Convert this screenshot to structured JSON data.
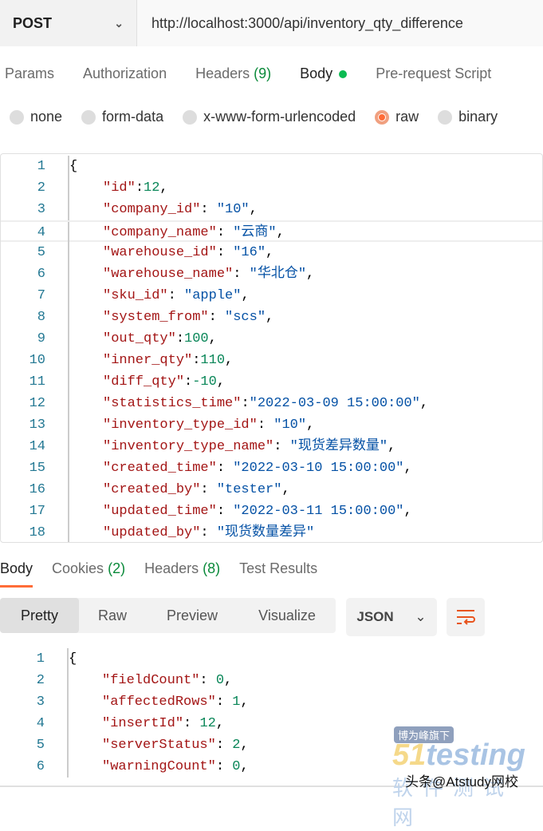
{
  "request": {
    "method": "POST",
    "url": "http://localhost:3000/api/inventory_qty_difference"
  },
  "tabs": [
    {
      "label": "Params"
    },
    {
      "label": "Authorization"
    },
    {
      "label": "Headers",
      "count": "(9)"
    },
    {
      "label": "Body",
      "active": true
    },
    {
      "label": "Pre-request Script"
    }
  ],
  "body_types": [
    {
      "label": "none"
    },
    {
      "label": "form-data"
    },
    {
      "label": "x-www-form-urlencoded"
    },
    {
      "label": "raw",
      "selected": true
    },
    {
      "label": "binary"
    }
  ],
  "request_body": [
    {
      "n": "1",
      "parts": [
        [
          "p",
          "{"
        ]
      ]
    },
    {
      "n": "2",
      "parts": [
        [
          "k",
          "\"id\""
        ],
        [
          "p",
          ":"
        ],
        [
          "n",
          "12"
        ],
        [
          "p",
          ","
        ]
      ]
    },
    {
      "n": "3",
      "parts": [
        [
          "k",
          "\"company_id\""
        ],
        [
          "p",
          ": "
        ],
        [
          "s",
          "\"10\""
        ],
        [
          "p",
          ","
        ]
      ]
    },
    {
      "n": "4",
      "parts": [
        [
          "k",
          "\"company_name\""
        ],
        [
          "p",
          ": "
        ],
        [
          "s",
          "\"云商\""
        ],
        [
          "p",
          ","
        ]
      ]
    },
    {
      "n": "5",
      "parts": [
        [
          "k",
          "\"warehouse_id\""
        ],
        [
          "p",
          ": "
        ],
        [
          "s",
          "\"16\""
        ],
        [
          "p",
          ","
        ]
      ]
    },
    {
      "n": "6",
      "parts": [
        [
          "k",
          "\"warehouse_name\""
        ],
        [
          "p",
          ": "
        ],
        [
          "s",
          "\"华北仓\""
        ],
        [
          "p",
          ","
        ]
      ]
    },
    {
      "n": "7",
      "parts": [
        [
          "k",
          "\"sku_id\""
        ],
        [
          "p",
          ": "
        ],
        [
          "s",
          "\"apple\""
        ],
        [
          "p",
          ","
        ]
      ]
    },
    {
      "n": "8",
      "parts": [
        [
          "k",
          "\"system_from\""
        ],
        [
          "p",
          ": "
        ],
        [
          "s",
          "\"scs\""
        ],
        [
          "p",
          ","
        ]
      ]
    },
    {
      "n": "9",
      "parts": [
        [
          "k",
          "\"out_qty\""
        ],
        [
          "p",
          ":"
        ],
        [
          "n",
          "100"
        ],
        [
          "p",
          ","
        ]
      ]
    },
    {
      "n": "10",
      "parts": [
        [
          "k",
          "\"inner_qty\""
        ],
        [
          "p",
          ":"
        ],
        [
          "n",
          "110"
        ],
        [
          "p",
          ","
        ]
      ]
    },
    {
      "n": "11",
      "parts": [
        [
          "k",
          "\"diff_qty\""
        ],
        [
          "p",
          ":"
        ],
        [
          "n",
          "-10"
        ],
        [
          "p",
          ","
        ]
      ]
    },
    {
      "n": "12",
      "parts": [
        [
          "k",
          "\"statistics_time\""
        ],
        [
          "p",
          ":"
        ],
        [
          "s",
          "\"2022-03-09 15:00:00\""
        ],
        [
          "p",
          ","
        ]
      ]
    },
    {
      "n": "13",
      "parts": [
        [
          "k",
          "\"inventory_type_id\""
        ],
        [
          "p",
          ": "
        ],
        [
          "s",
          "\"10\""
        ],
        [
          "p",
          ","
        ]
      ]
    },
    {
      "n": "14",
      "parts": [
        [
          "k",
          "\"inventory_type_name\""
        ],
        [
          "p",
          ": "
        ],
        [
          "s",
          "\"现货差异数量\""
        ],
        [
          "p",
          ","
        ]
      ]
    },
    {
      "n": "15",
      "parts": [
        [
          "k",
          "\"created_time\""
        ],
        [
          "p",
          ": "
        ],
        [
          "s",
          "\"2022-03-10 15:00:00\""
        ],
        [
          "p",
          ","
        ]
      ]
    },
    {
      "n": "16",
      "parts": [
        [
          "k",
          "\"created_by\""
        ],
        [
          "p",
          ": "
        ],
        [
          "s",
          "\"tester\""
        ],
        [
          "p",
          ","
        ]
      ]
    },
    {
      "n": "17",
      "parts": [
        [
          "k",
          "\"updated_time\""
        ],
        [
          "p",
          ": "
        ],
        [
          "s",
          "\"2022-03-11 15:00:00\""
        ],
        [
          "p",
          ","
        ]
      ]
    },
    {
      "n": "18",
      "parts": [
        [
          "k",
          "\"updated_by\""
        ],
        [
          "p",
          ": "
        ],
        [
          "s",
          "\"现货数量差异\""
        ]
      ]
    }
  ],
  "response_tabs": [
    {
      "label": "Body",
      "active": true
    },
    {
      "label": "Cookies",
      "count": "(2)"
    },
    {
      "label": "Headers",
      "count": "(8)"
    },
    {
      "label": "Test Results"
    }
  ],
  "view_modes": [
    "Pretty",
    "Raw",
    "Preview",
    "Visualize"
  ],
  "format": "JSON",
  "response_body": [
    {
      "n": "1",
      "parts": [
        [
          "p",
          "{"
        ]
      ]
    },
    {
      "n": "2",
      "parts": [
        [
          "k",
          "\"fieldCount\""
        ],
        [
          "p",
          ": "
        ],
        [
          "n",
          "0"
        ],
        [
          "p",
          ","
        ]
      ]
    },
    {
      "n": "3",
      "parts": [
        [
          "k",
          "\"affectedRows\""
        ],
        [
          "p",
          ": "
        ],
        [
          "n",
          "1"
        ],
        [
          "p",
          ","
        ]
      ]
    },
    {
      "n": "4",
      "parts": [
        [
          "k",
          "\"insertId\""
        ],
        [
          "p",
          ": "
        ],
        [
          "n",
          "12"
        ],
        [
          "p",
          ","
        ]
      ]
    },
    {
      "n": "5",
      "parts": [
        [
          "k",
          "\"serverStatus\""
        ],
        [
          "p",
          ": "
        ],
        [
          "n",
          "2"
        ],
        [
          "p",
          ","
        ]
      ]
    },
    {
      "n": "6",
      "parts": [
        [
          "k",
          "\"warningCount\""
        ],
        [
          "p",
          ": "
        ],
        [
          "n",
          "0"
        ],
        [
          "p",
          ","
        ]
      ]
    }
  ],
  "watermark": {
    "tag": "博为峰旗下",
    "logo": "51testing",
    "sub": "软件测试网",
    "credit": "头条@Atstudy网校"
  },
  "colors": {
    "accent": "#ff6c37",
    "key": "#a31515",
    "string": "#0451a5",
    "number": "#098658"
  }
}
